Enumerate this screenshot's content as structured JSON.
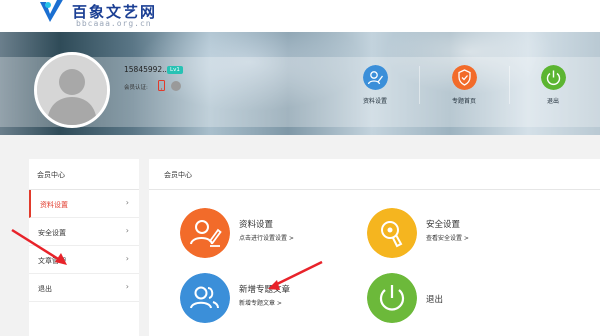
{
  "site": {
    "name": "百象文艺网",
    "domain": "bbcaaa.org.cn"
  },
  "profile": {
    "phone": "15845992...",
    "level": "Lv1",
    "verify_label": "会员认证:"
  },
  "quick_links": [
    {
      "label": "资料设置",
      "icon": "user-edit-icon",
      "color": "#3b8fd9"
    },
    {
      "label": "专题首页",
      "icon": "shield-icon",
      "color": "#f26b2a"
    },
    {
      "label": "退出",
      "icon": "power-icon",
      "color": "#5cb531"
    }
  ],
  "sidebar": {
    "title": "会员中心",
    "items": [
      {
        "label": "资料设置",
        "active": true
      },
      {
        "label": "安全设置",
        "active": false
      },
      {
        "label": "文章管理",
        "active": false
      },
      {
        "label": "退出",
        "active": false
      }
    ],
    "chevron": "›"
  },
  "main": {
    "title": "会员中心",
    "cards": [
      {
        "title": "资料设置",
        "desc": "点击进行设置设置 >",
        "icon": "user-edit-icon",
        "color": "#f26b2a"
      },
      {
        "title": "安全设置",
        "desc": "查看安全设置 >",
        "icon": "security-icon",
        "color": "#f5b51f"
      },
      {
        "title": "新增专题文章",
        "desc": "新增专题文章 >",
        "icon": "users-icon",
        "color": "#3b8fd9"
      },
      {
        "title": "退出",
        "desc": "",
        "icon": "power-icon",
        "color": "#6cb93a"
      }
    ]
  },
  "colors": {
    "accent_red": "#e13a2b",
    "logo_blue": "#1b3f94",
    "annotation_red": "#e8232a"
  }
}
